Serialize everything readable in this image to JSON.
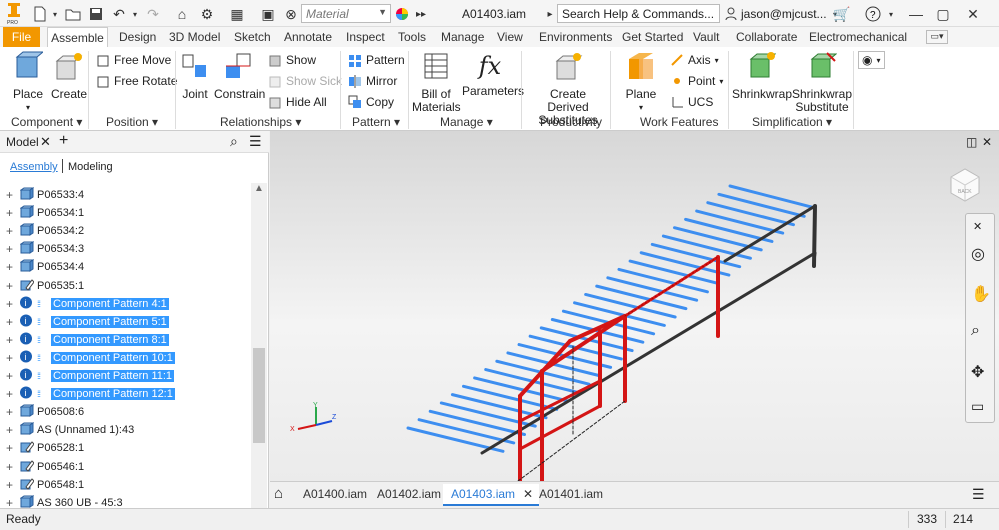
{
  "qat": {
    "material": "Material",
    "doc_title": "A01403.iam",
    "search_placeholder": "Search Help & Commands...",
    "user": "jason@mjcust..."
  },
  "tabs": [
    "File",
    "Assemble",
    "Design",
    "3D Model",
    "Sketch",
    "Annotate",
    "Inspect",
    "Tools",
    "Manage",
    "View",
    "Environments",
    "Get Started",
    "Vault",
    "Collaborate",
    "Electromechanical"
  ],
  "ribbon": {
    "place": "Place",
    "create": "Create",
    "free_move": "Free Move",
    "free_rotate": "Free Rotate",
    "joint": "Joint",
    "constrain": "Constrain",
    "show": "Show",
    "show_sick": "Show Sick",
    "hide_all": "Hide All",
    "pattern": "Pattern",
    "mirror": "Mirror",
    "copy": "Copy",
    "bom_1": "Bill of",
    "bom_2": "Materials",
    "parameters": "Parameters",
    "create_derived_1": "Create Derived",
    "create_derived_2": "Substitutes",
    "plane": "Plane",
    "axis": "Axis",
    "point": "Point",
    "ucs": "UCS",
    "shrinkwrap": "Shrinkwrap",
    "shrinkwrap_sub_1": "Shrinkwrap",
    "shrinkwrap_sub_2": "Substitute",
    "panels": {
      "component": "Component",
      "position": "Position",
      "relationships": "Relationships",
      "pattern": "Pattern",
      "manage": "Manage",
      "productivity": "Productivity",
      "work_features": "Work Features",
      "simplification": "Simplification"
    }
  },
  "browser": {
    "title": "Model",
    "tab_assembly": "Assembly",
    "tab_modeling": "Modeling",
    "items": [
      {
        "label": "P06533:4",
        "type": "part"
      },
      {
        "label": "P06534:1",
        "type": "part"
      },
      {
        "label": "P06534:2",
        "type": "part"
      },
      {
        "label": "P06534:3",
        "type": "part"
      },
      {
        "label": "P06534:4",
        "type": "part"
      },
      {
        "label": "P06535:1",
        "type": "edit"
      },
      {
        "label": "Component Pattern 4:1",
        "type": "pattern"
      },
      {
        "label": "Component Pattern 5:1",
        "type": "pattern"
      },
      {
        "label": "Component Pattern 8:1",
        "type": "pattern"
      },
      {
        "label": "Component Pattern 10:1",
        "type": "pattern"
      },
      {
        "label": "Component Pattern 11:1",
        "type": "pattern"
      },
      {
        "label": "Component Pattern 12:1",
        "type": "pattern"
      },
      {
        "label": "P06508:6",
        "type": "part"
      },
      {
        "label": "AS (Unnamed 1):43",
        "type": "part"
      },
      {
        "label": "P06528:1",
        "type": "edit"
      },
      {
        "label": "P06546:1",
        "type": "edit"
      },
      {
        "label": "P06548:1",
        "type": "edit"
      },
      {
        "label": "AS 360 UB - 45:3",
        "type": "part"
      }
    ]
  },
  "doc_tabs": [
    "A01400.iam",
    "A01402.iam",
    "A01403.iam",
    "A01401.iam"
  ],
  "status": {
    "left": "Ready",
    "n1": "333",
    "n2": "214"
  },
  "viewcube_label": "BACK",
  "colors": {
    "file_tab": "#f29700",
    "selection": "#3399ff",
    "purlin": "#3d8ef0",
    "frame": "#d41515",
    "post": "#333333"
  }
}
